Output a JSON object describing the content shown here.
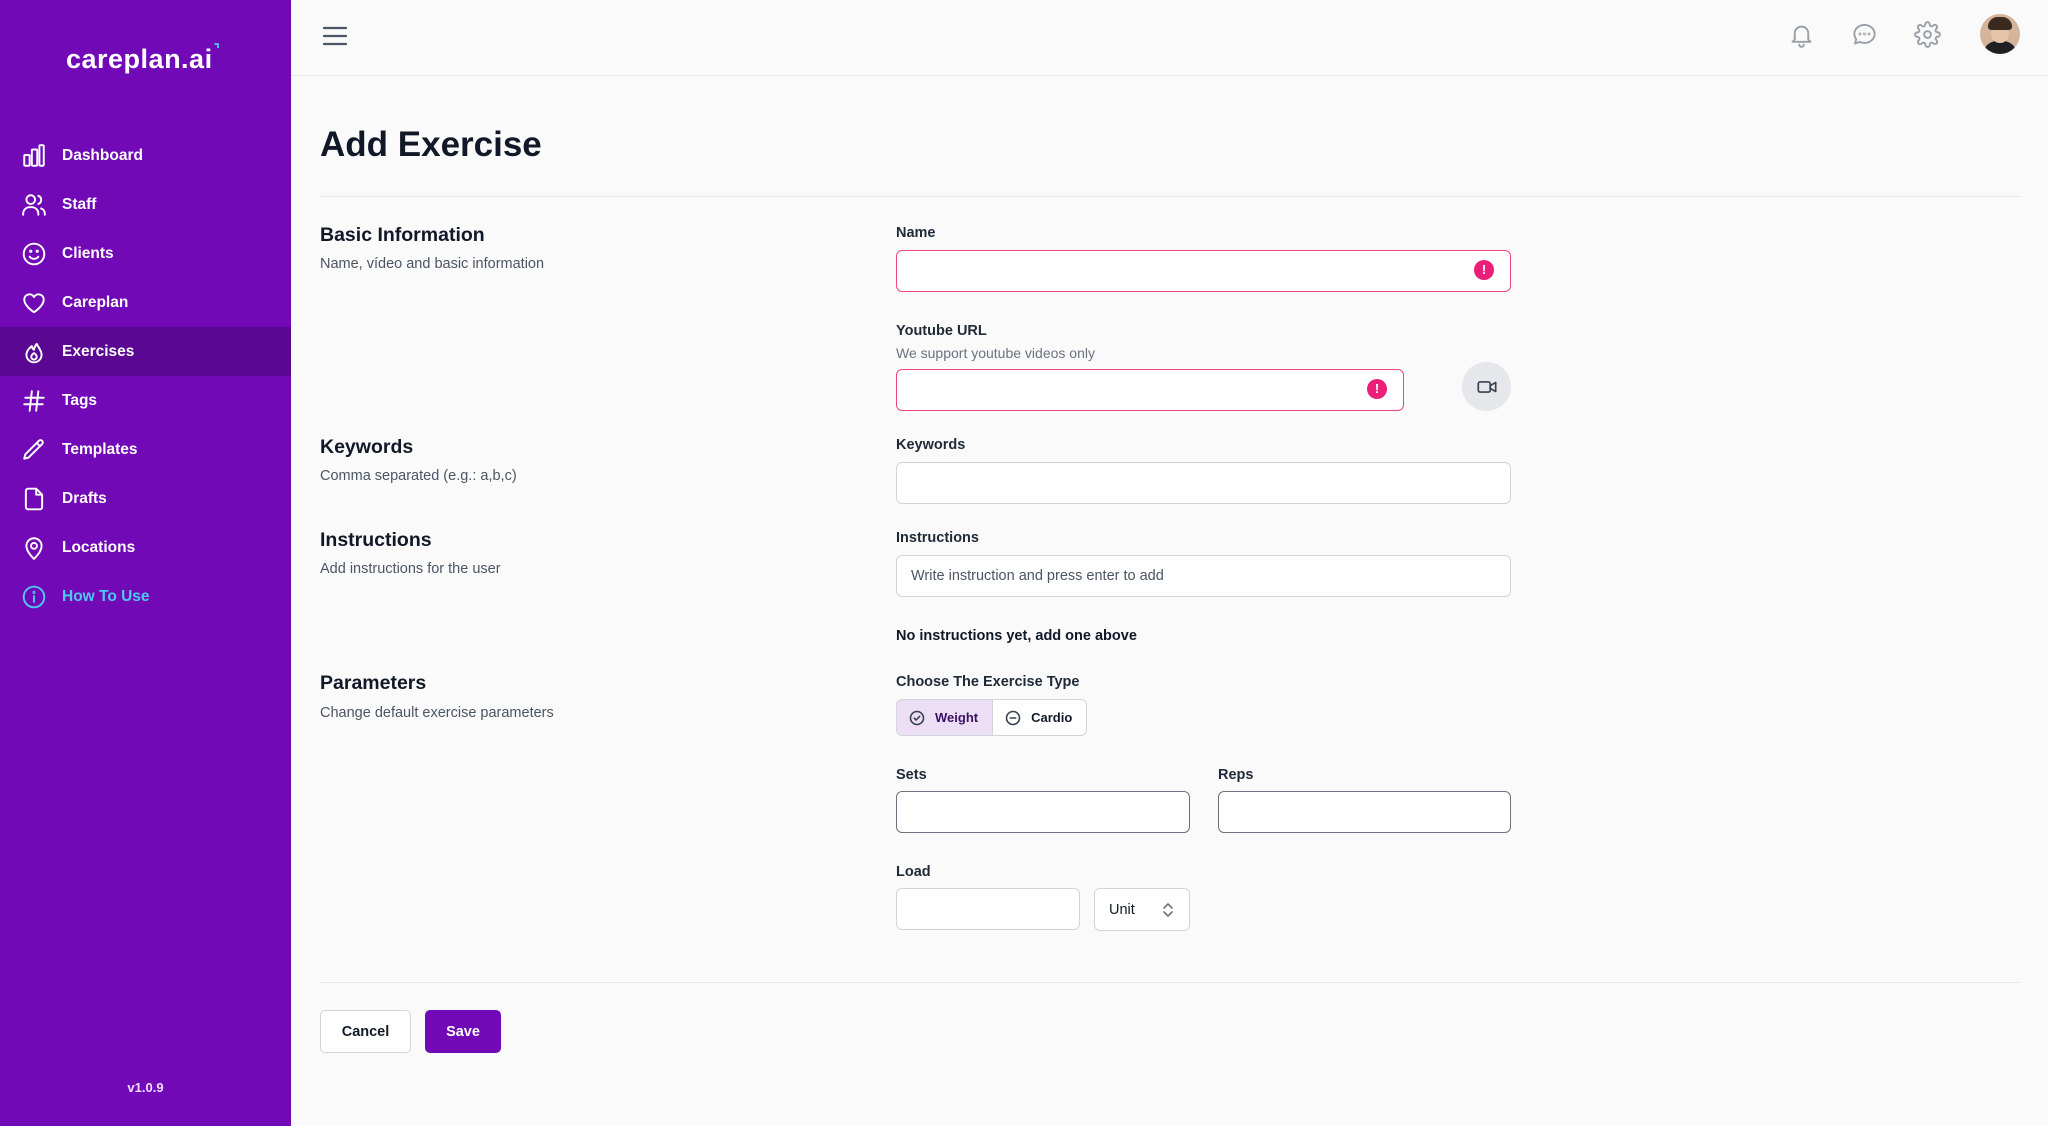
{
  "app": {
    "logo": "careplan.ai",
    "version": "v1.0.9"
  },
  "sidebar": {
    "items": [
      {
        "label": "Dashboard",
        "icon": "chart-bar-icon"
      },
      {
        "label": "Staff",
        "icon": "users-icon"
      },
      {
        "label": "Clients",
        "icon": "smile-icon"
      },
      {
        "label": "Careplan",
        "icon": "heart-icon"
      },
      {
        "label": "Exercises",
        "icon": "fire-icon",
        "active": true
      },
      {
        "label": "Tags",
        "icon": "hashtag-icon"
      },
      {
        "label": "Templates",
        "icon": "pencil-icon"
      },
      {
        "label": "Drafts",
        "icon": "document-icon"
      },
      {
        "label": "Locations",
        "icon": "location-pin-icon"
      },
      {
        "label": "How To Use",
        "icon": "info-icon"
      }
    ]
  },
  "colors": {
    "brand": "#7209b7",
    "active_nav": "#5a0894",
    "help_link": "#4cc9f0",
    "error": "#ec1f78"
  },
  "page": {
    "title": "Add Exercise"
  },
  "sections": {
    "basic": {
      "title": "Basic Information",
      "desc": "Name, vídeo and basic information"
    },
    "keywords": {
      "title": "Keywords",
      "desc": "Comma separated (e.g.: a,b,c)"
    },
    "instructions": {
      "title": "Instructions",
      "desc": "Add instructions for the user"
    },
    "parameters": {
      "title": "Parameters",
      "desc": "Change default exercise parameters"
    }
  },
  "fields": {
    "name": {
      "label": "Name",
      "value": ""
    },
    "youtube": {
      "label": "Youtube URL",
      "hint": "We support youtube videos only",
      "value": ""
    },
    "keywords": {
      "label": "Keywords",
      "value": ""
    },
    "instructions": {
      "label": "Instructions",
      "placeholder": "Write instruction and press enter to add",
      "empty_text": "No instructions yet, add one above"
    },
    "exercise_type": {
      "label": "Choose The Exercise Type",
      "options": [
        "Weight",
        "Cardio"
      ],
      "selected": "Weight"
    },
    "sets": {
      "label": "Sets",
      "value": ""
    },
    "reps": {
      "label": "Reps",
      "value": ""
    },
    "load": {
      "label": "Load",
      "value": "",
      "unit": "Unit"
    }
  },
  "actions": {
    "cancel": "Cancel",
    "save": "Save"
  }
}
